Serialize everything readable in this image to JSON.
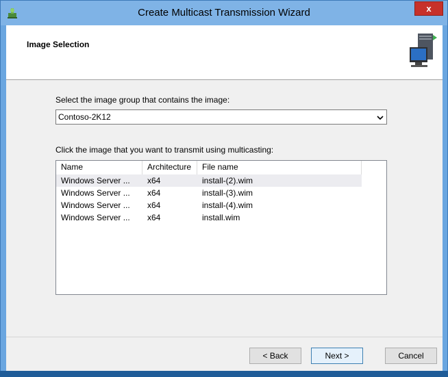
{
  "window": {
    "title": "Create Multicast Transmission Wizard",
    "close_label": "x",
    "icon": "wds-wizard-icon"
  },
  "header": {
    "title": "Image Selection",
    "icon": "server-monitor-icon"
  },
  "group": {
    "label": "Select the image group that contains the image:",
    "selected": "Contoso-2K12"
  },
  "images": {
    "label": "Click the image that you want to transmit using multicasting:",
    "columns": [
      "Name",
      "Architecture",
      "File name"
    ],
    "rows": [
      {
        "name": "Windows Server ...",
        "arch": "x64",
        "file": "install-(2).wim"
      },
      {
        "name": "Windows Server ...",
        "arch": "x64",
        "file": "install-(3).wim"
      },
      {
        "name": "Windows Server ...",
        "arch": "x64",
        "file": "install-(4).wim"
      },
      {
        "name": "Windows Server ...",
        "arch": "x64",
        "file": "install.wim"
      }
    ]
  },
  "buttons": {
    "back": "< Back",
    "next": "Next >",
    "cancel": "Cancel"
  },
  "colors": {
    "titlebar": "#7fb3e6",
    "close": "#c7312a",
    "selection": "#ececf0"
  }
}
